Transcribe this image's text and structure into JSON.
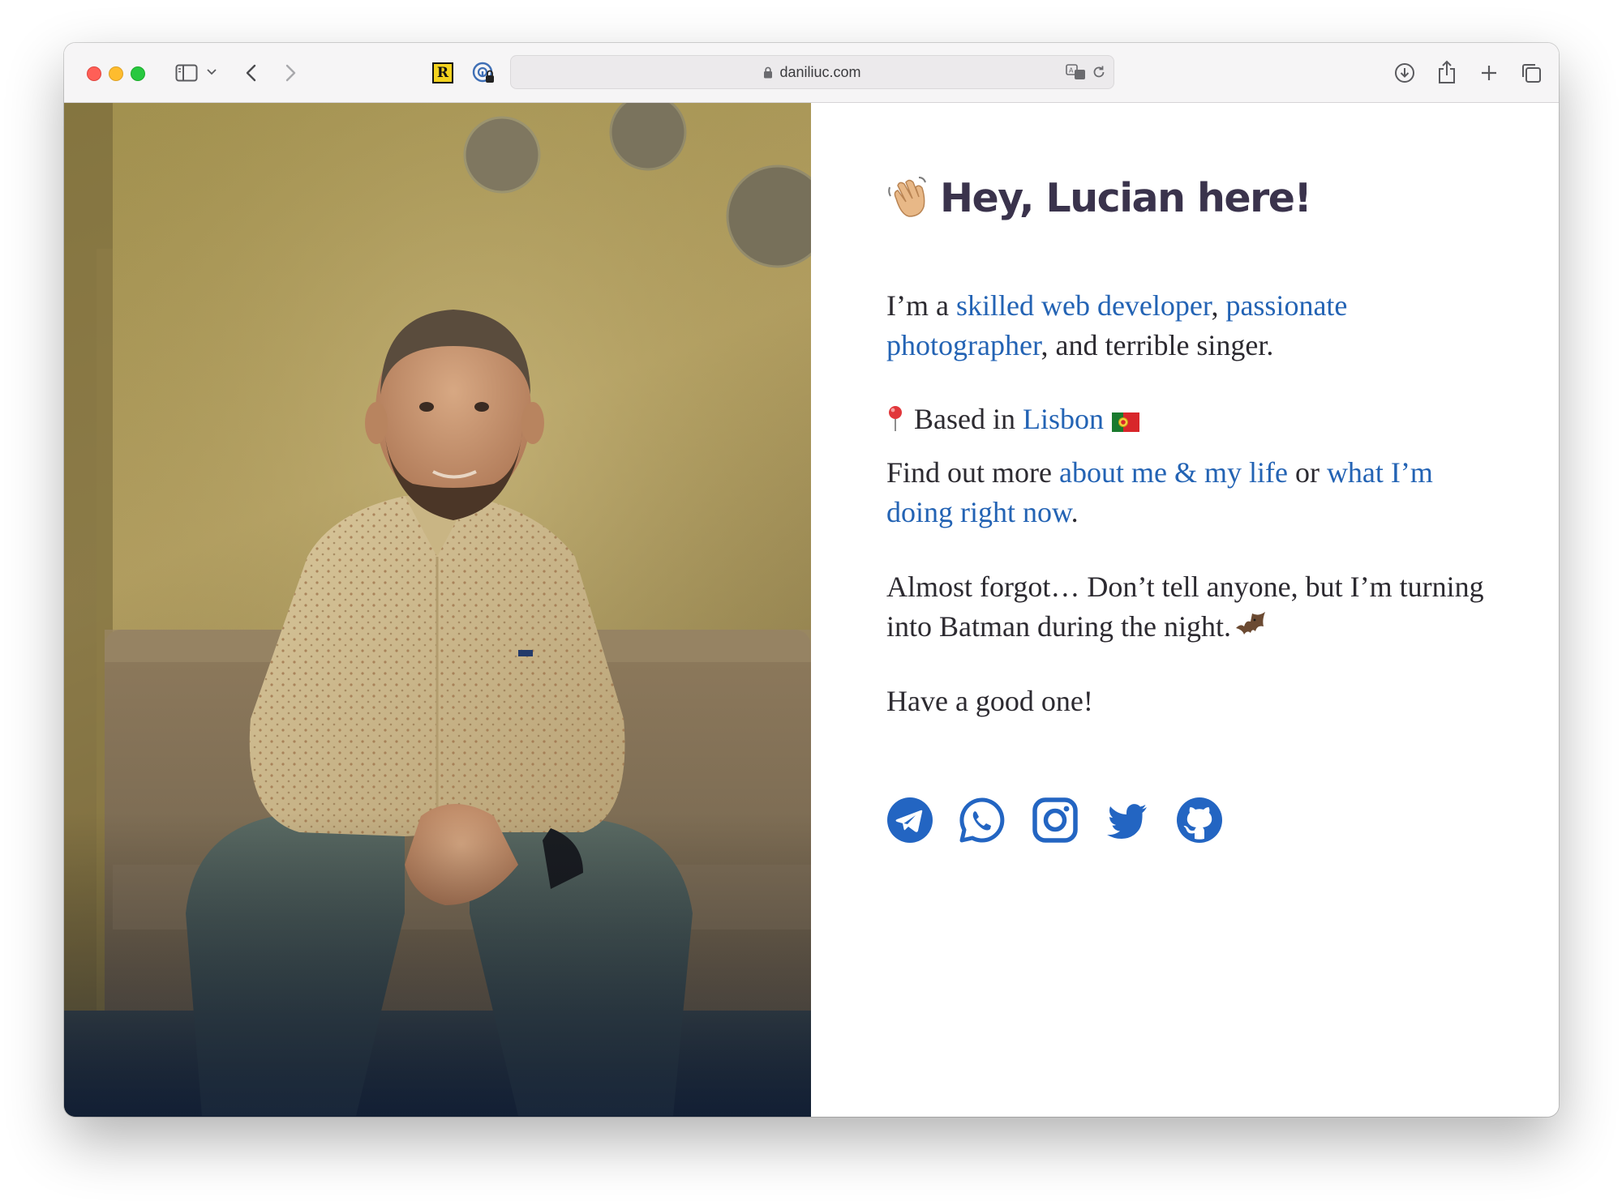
{
  "browser": {
    "url": "daniliuc.com",
    "extension_r_label": "R"
  },
  "page": {
    "heading": "Hey, Lucian here!",
    "intro": {
      "prefix": "I’m a ",
      "link1": "skilled web developer",
      "sep1": ", ",
      "link2": "passionate photographer",
      "suffix": ", and terrible singer."
    },
    "location": {
      "prefix": "Based in ",
      "link": "Lisbon"
    },
    "more": {
      "prefix": "Find out more ",
      "link1": "about me & my life",
      "mid": " or ",
      "link2": "what I’m doing right now",
      "suffix": "."
    },
    "secret": "Almost forgot… Don’t tell anyone, but I’m turning into Batman during the night.",
    "signoff": "Have a good one!",
    "socials": [
      "telegram-icon",
      "whatsapp-icon",
      "instagram-icon",
      "twitter-icon",
      "github-icon"
    ]
  },
  "colors": {
    "link": "#2363b4",
    "heading": "#3a334c",
    "body_text": "#2c2a30",
    "social_icons": "#2365c2"
  }
}
